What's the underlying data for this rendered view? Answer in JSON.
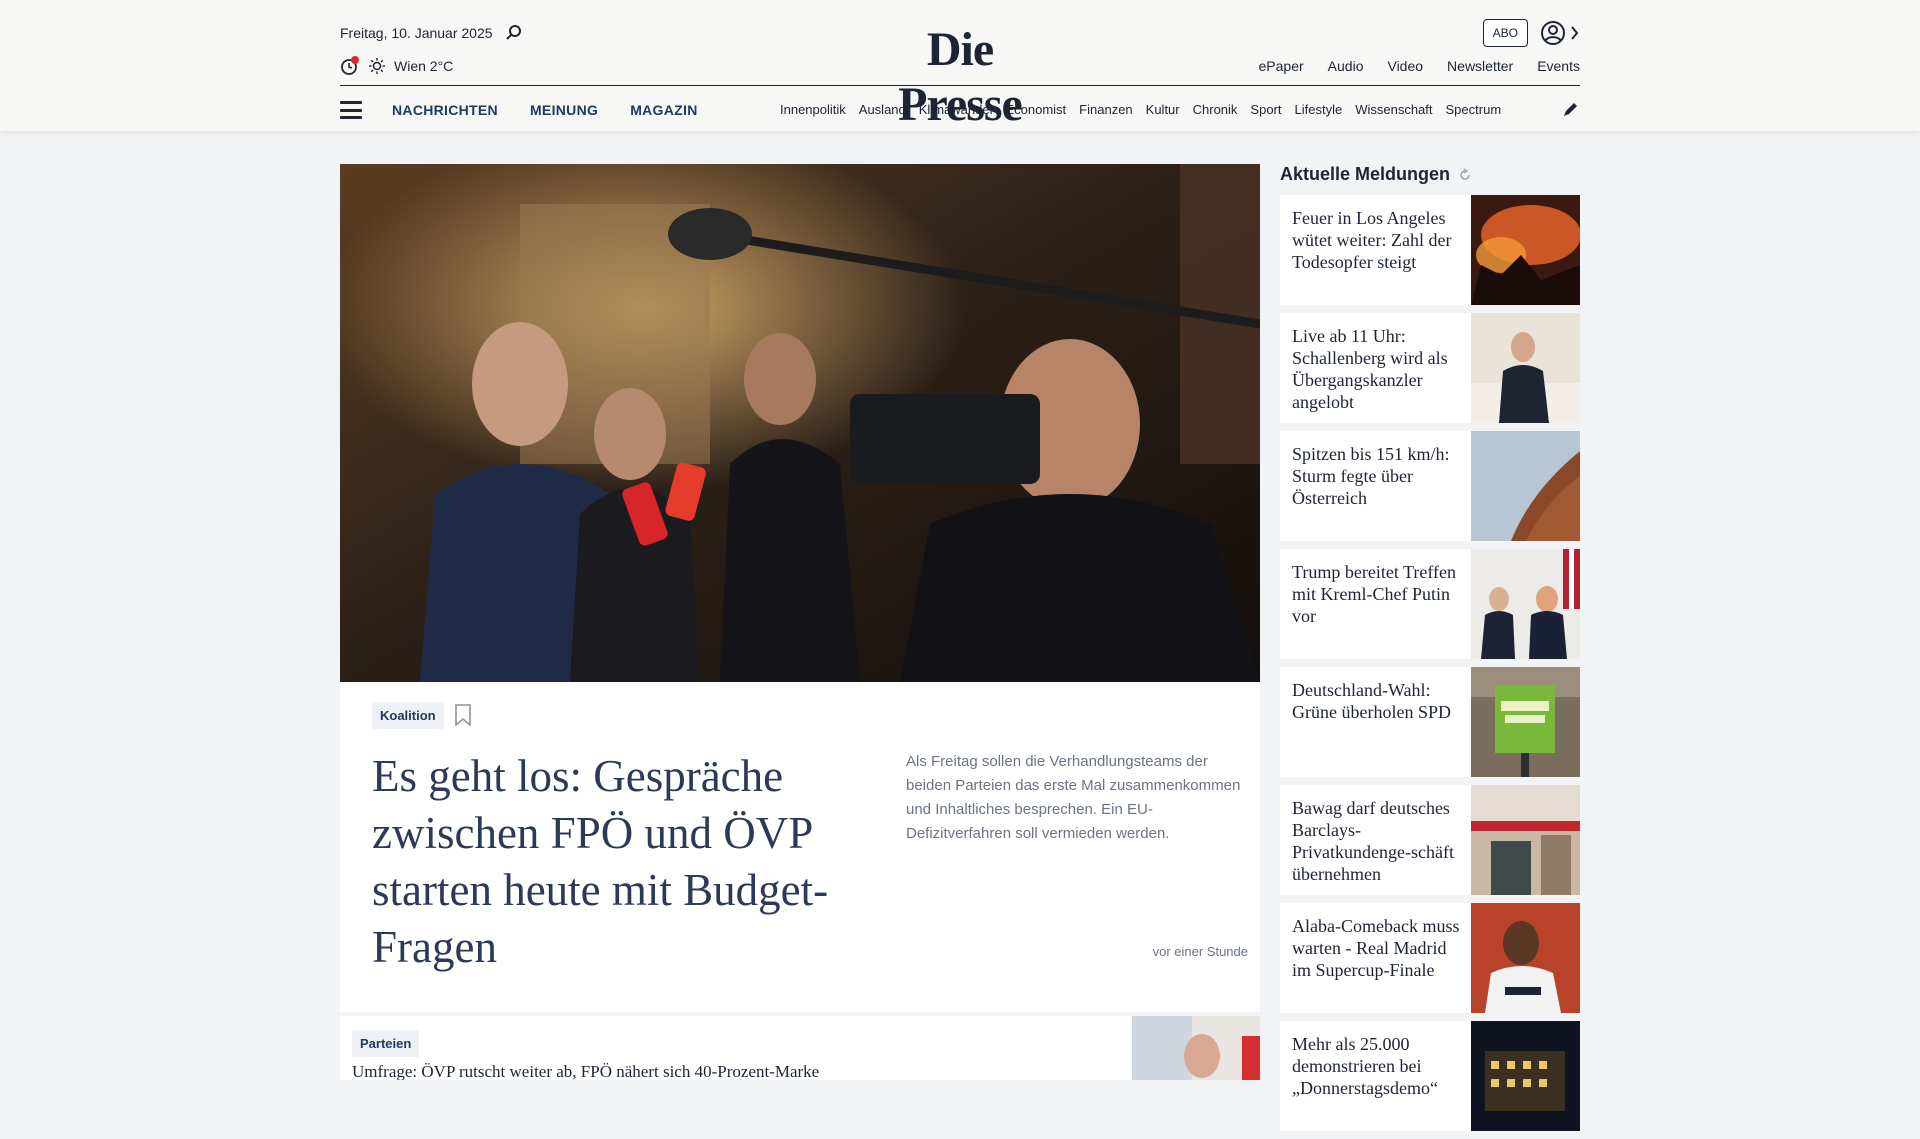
{
  "header": {
    "date": "Freitag, 10. Januar 2025",
    "weather": "Wien 2°C",
    "logo": "Die Presse",
    "abo_label": "ABO",
    "util_links": [
      "ePaper",
      "Audio",
      "Video",
      "Newsletter",
      "Events"
    ]
  },
  "nav": {
    "main": [
      "NACHRICHTEN",
      "MEINUNG",
      "MAGAZIN"
    ],
    "sub": [
      "Innenpolitik",
      "Ausland",
      "Klimawandel",
      "Economist",
      "Finanzen",
      "Kultur",
      "Chronik",
      "Sport",
      "Lifestyle",
      "Wissenschaft",
      "Spectrum"
    ]
  },
  "lead": {
    "tag": "Koalition",
    "headline": "Es geht los: Gespräche zwischen FPÖ und ÖVP starten heute mit Budget-Fragen",
    "teaser": "Als Freitag sollen die Verhandlungsteams der beiden Parteien das erste Mal zusammenkommen und Inhaltliches besprechen. Ein EU-Defizitverfahren soll vermieden werden.",
    "time": "vor einer Stunde"
  },
  "second": {
    "tag": "Parteien",
    "title": "Umfrage: ÖVP rutscht weiter ab, FPÖ nähert sich 40-Prozent-Marke"
  },
  "sidebar": {
    "title": "Aktuelle Meldungen",
    "items": [
      {
        "title": "Feuer in Los Angeles wütet weiter: Zahl der Todesopfer steigt"
      },
      {
        "title": "Live ab 11 Uhr: Schallenberg wird als Übergangskanzler angelobt"
      },
      {
        "title": "Spitzen bis 151 km/h: Sturm fegte über Österreich"
      },
      {
        "title": "Trump bereitet Treffen mit Kreml-Chef Putin vor"
      },
      {
        "title": "Deutschland-Wahl: Grüne überholen SPD"
      },
      {
        "title": "Bawag darf deutsches Barclays-Privatkundenge-schäft übernehmen"
      },
      {
        "title": "Alaba-Comeback muss warten - Real Madrid im Supercup-Finale"
      },
      {
        "title": "Mehr als 25.000 demonstrieren bei „Donnerstagsdemo“"
      }
    ]
  },
  "colors": {
    "accent": "#1f3a62",
    "notification": "#e0262b",
    "tag_bg": "#eef1f5"
  }
}
